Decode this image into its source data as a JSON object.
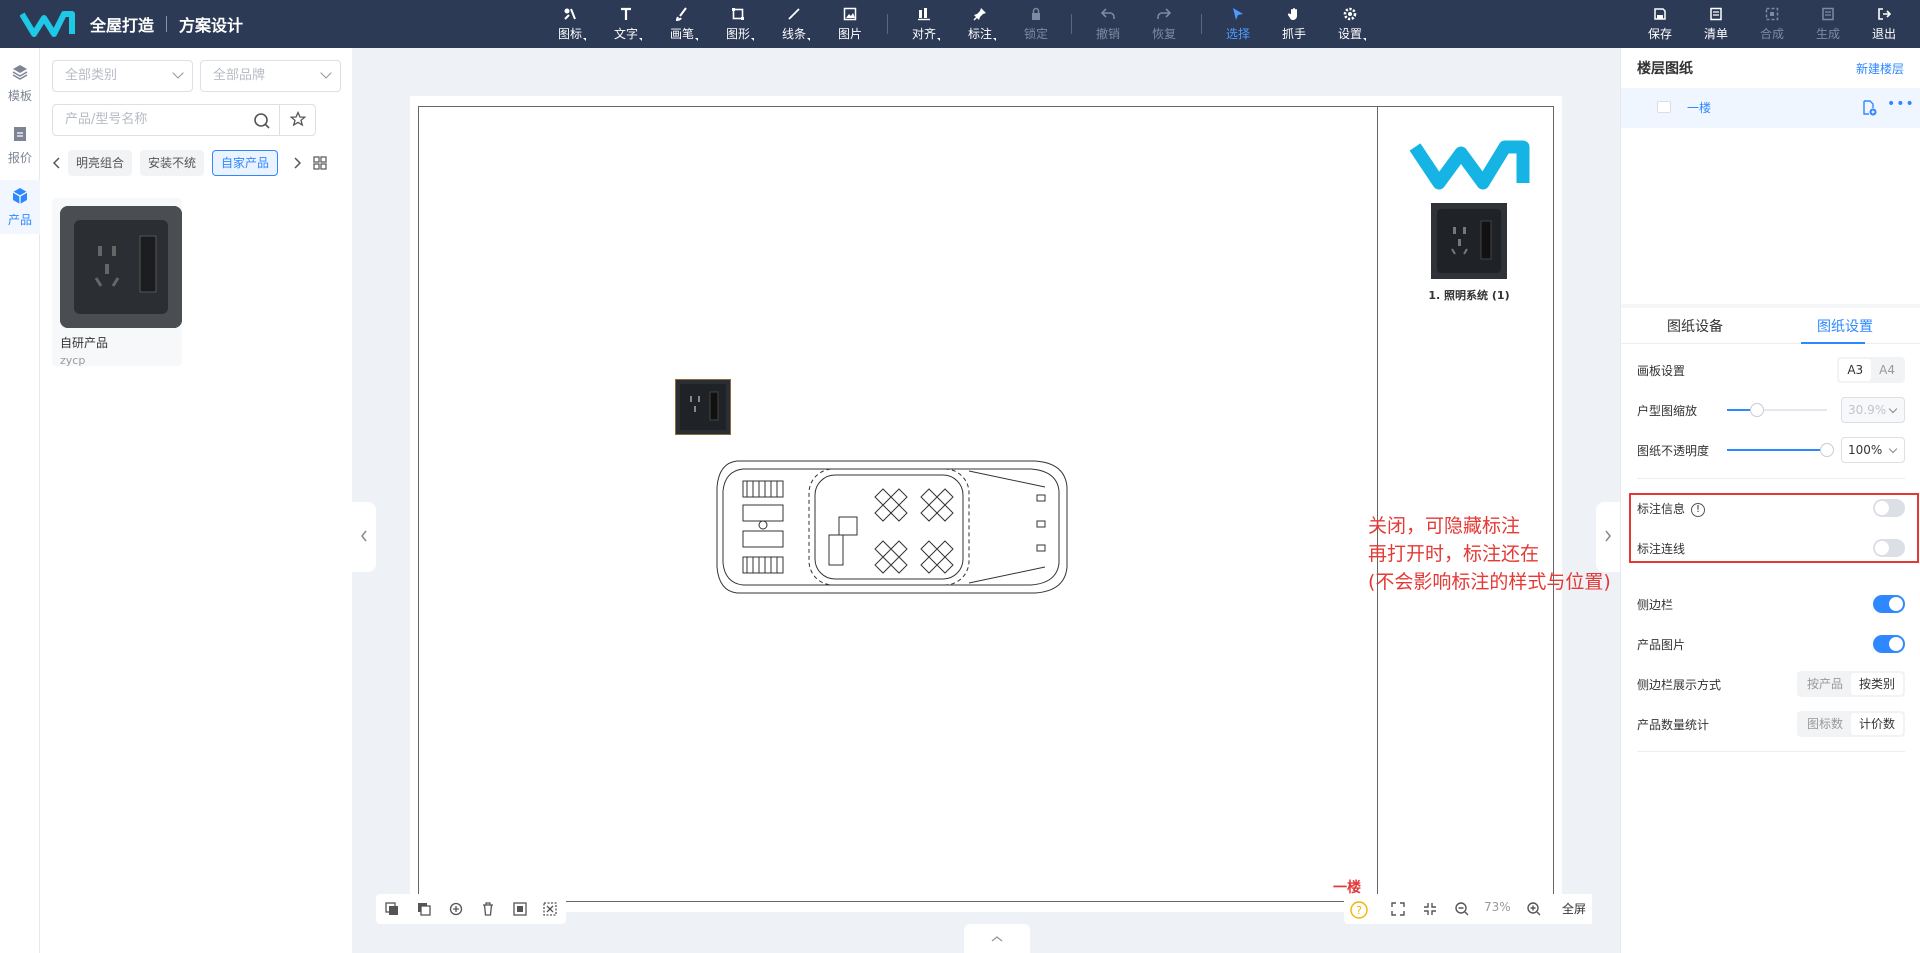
{
  "header": {
    "brand_title": "全屋打造",
    "brand_subtitle": "方案设计",
    "tools": [
      {
        "label": "图标",
        "icon": "icon-tool-icon"
      },
      {
        "label": "文字",
        "icon": "text-icon"
      },
      {
        "label": "画笔",
        "icon": "brush-icon"
      },
      {
        "label": "图形",
        "icon": "shape-icon"
      },
      {
        "label": "线条",
        "icon": "line-icon"
      },
      {
        "label": "图片",
        "icon": "image-icon"
      },
      {
        "label": "对齐",
        "icon": "align-icon"
      },
      {
        "label": "标注",
        "icon": "pin-icon"
      },
      {
        "label": "锁定",
        "icon": "lock-icon"
      },
      {
        "label": "撤销",
        "icon": "undo-icon"
      },
      {
        "label": "恢复",
        "icon": "redo-icon"
      },
      {
        "label": "选择",
        "icon": "cursor-icon"
      },
      {
        "label": "抓手",
        "icon": "hand-icon"
      },
      {
        "label": "设置",
        "icon": "gear-icon"
      }
    ],
    "actions": [
      {
        "label": "保存",
        "icon": "save-icon"
      },
      {
        "label": "清单",
        "icon": "list-icon"
      },
      {
        "label": "合成",
        "icon": "compose-icon"
      },
      {
        "label": "生成",
        "icon": "generate-icon"
      },
      {
        "label": "退出",
        "icon": "exit-icon"
      }
    ],
    "bg_color": "#2c3a55",
    "active_color": "#4f9bff"
  },
  "rail": [
    {
      "label": "模板",
      "icon": "layers-icon"
    },
    {
      "label": "报价",
      "icon": "quote-icon"
    },
    {
      "label": "产品",
      "icon": "cube-icon"
    }
  ],
  "product_panel": {
    "category_placeholder": "全部类别",
    "brand_placeholder": "全部品牌",
    "search_placeholder": "产品/型号名称",
    "tags": [
      "明亮组合",
      "安装不统",
      "自家产品"
    ],
    "products": [
      {
        "name": "自研产品",
        "code": "zycp"
      }
    ]
  },
  "canvas": {
    "floor_label": "一楼",
    "legend_caption": "1. 照明系统 (1)",
    "zoom": "73%",
    "fullscreen_label": "全屏"
  },
  "annotation": {
    "lines": [
      "关闭，可隐藏标注",
      "再打开时，标注还在",
      "(不会影响标注的样式与位置)"
    ],
    "color": "#e53935"
  },
  "right_panel": {
    "title": "楼层图纸",
    "new_floor": "新建楼层",
    "floor_name": "一楼",
    "tab_devices": "图纸设备",
    "tab_settings": "图纸设置",
    "board_label": "画板设置",
    "board_options": [
      "A3",
      "A4"
    ],
    "scale_label": "户型图缩放",
    "scale_value": "30.9%",
    "scale_level": 0.3,
    "opacity_label": "图纸不透明度",
    "opacity_value": "100%",
    "opacity_level": 1.0,
    "annot_info_label": "标注信息",
    "annot_info_on": false,
    "annot_line_label": "标注连线",
    "annot_line_on": false,
    "sidebar_label": "侧边栏",
    "sidebar_on": true,
    "product_image_label": "产品图片",
    "product_image_on": true,
    "sidebar_mode_label": "侧边栏展示方式",
    "sidebar_mode_options": [
      "按产品",
      "按类别"
    ],
    "count_label": "产品数量统计",
    "count_options": [
      "图标数",
      "计价数"
    ]
  }
}
